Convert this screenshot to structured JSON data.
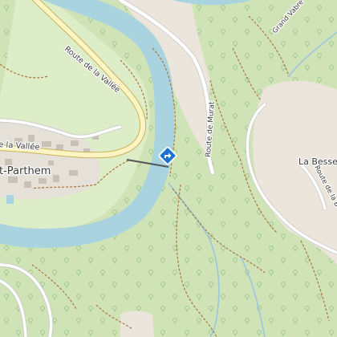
{
  "map": {
    "labels": {
      "road_vallee_north": "Route de la Vallée",
      "road_vallee_west": "e la Vallée",
      "road_murat": "Route de Murat",
      "road_besse_partial": "Route de la B",
      "place_grand_vabre": "Grand Vabre",
      "place_la_besse": "La Besse",
      "village_partial": "t-Parthem"
    },
    "poi": {
      "icon": "direction-arrow-icon",
      "color": "#1e73d2"
    },
    "colors": {
      "forest": "#cfe3b7",
      "meadow": "#dcedc7",
      "clearing": "#ece5dc",
      "river": "#a9d3df",
      "road_fill": "#fcf4c2",
      "road_casing": "#c9b35a",
      "track": "#a8763e"
    }
  }
}
